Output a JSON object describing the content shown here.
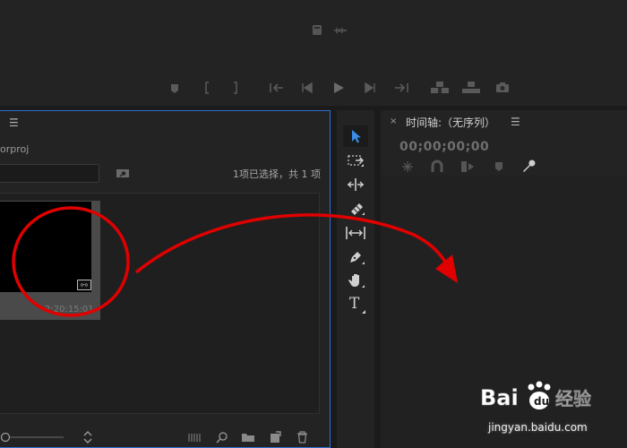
{
  "project_panel": {
    "menu_icon": "☰",
    "project_name": "orproj",
    "selection_info": "1项已选择，共 1 项",
    "clip": {
      "duration": "2:20:15:01",
      "badge": "⧟"
    }
  },
  "timeline_panel": {
    "close_label": "×",
    "title": "时间轴:（无序列）",
    "menu_icon": "☰",
    "timecode": "00;00;00;00"
  },
  "tools": [
    {
      "name": "selection-tool",
      "active": true
    },
    {
      "name": "track-select-tool"
    },
    {
      "name": "ripple-edit-tool"
    },
    {
      "name": "razor-tool"
    },
    {
      "name": "slip-tool"
    },
    {
      "name": "pen-tool"
    },
    {
      "name": "hand-tool"
    },
    {
      "name": "type-tool"
    }
  ],
  "type_tool_glyph": "T",
  "watermark": {
    "brand": "Bai 经验",
    "url": "jingyan.baidu.com"
  },
  "colors": {
    "accent": "#2f6fd1",
    "annotation": "#e00000",
    "background": "#232323"
  }
}
